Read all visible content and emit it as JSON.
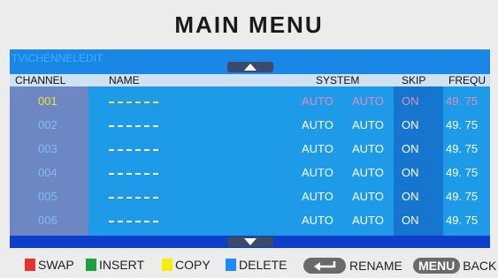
{
  "title": "MAIN MENU",
  "breadcrumb": "TV\\CHENNELEDIT",
  "columns": {
    "channel": "CHANNEL",
    "name": "NAME",
    "system": "SYSTEM",
    "skip": "SKIP",
    "frequ": "FREQU"
  },
  "rows": [
    {
      "channel": "001",
      "sys1": "AUTO",
      "sys2": "AUTO",
      "skip": "ON",
      "freq": "49. 75",
      "selected": true
    },
    {
      "channel": "002",
      "sys1": "AUTO",
      "sys2": "AUTO",
      "skip": "ON",
      "freq": "49. 75"
    },
    {
      "channel": "003",
      "sys1": "AUTO",
      "sys2": "AUTO",
      "skip": "ON",
      "freq": "49. 75"
    },
    {
      "channel": "004",
      "sys1": "AUTO",
      "sys2": "AUTO",
      "skip": "ON",
      "freq": "49. 75"
    },
    {
      "channel": "005",
      "sys1": "AUTO",
      "sys2": "AUTO",
      "skip": "ON",
      "freq": "49. 75"
    },
    {
      "channel": "006",
      "sys1": "AUTO",
      "sys2": "AUTO",
      "skip": "ON",
      "freq": "49. 75"
    }
  ],
  "footer": {
    "swap": "SWAP",
    "insert": "INSERT",
    "copy": "COPY",
    "delete": "DELETE",
    "rename": "RENAME",
    "menu_key": "MENU",
    "back": "BACK"
  },
  "colors": {
    "swap": "#e63232",
    "insert": "#1ea03c",
    "copy": "#f5f000",
    "delete": "#1e8cff"
  },
  "icons": {
    "scroll_up": "triangle-up-icon",
    "scroll_down": "triangle-down-icon",
    "rename_key": "return-arrow-icon"
  }
}
